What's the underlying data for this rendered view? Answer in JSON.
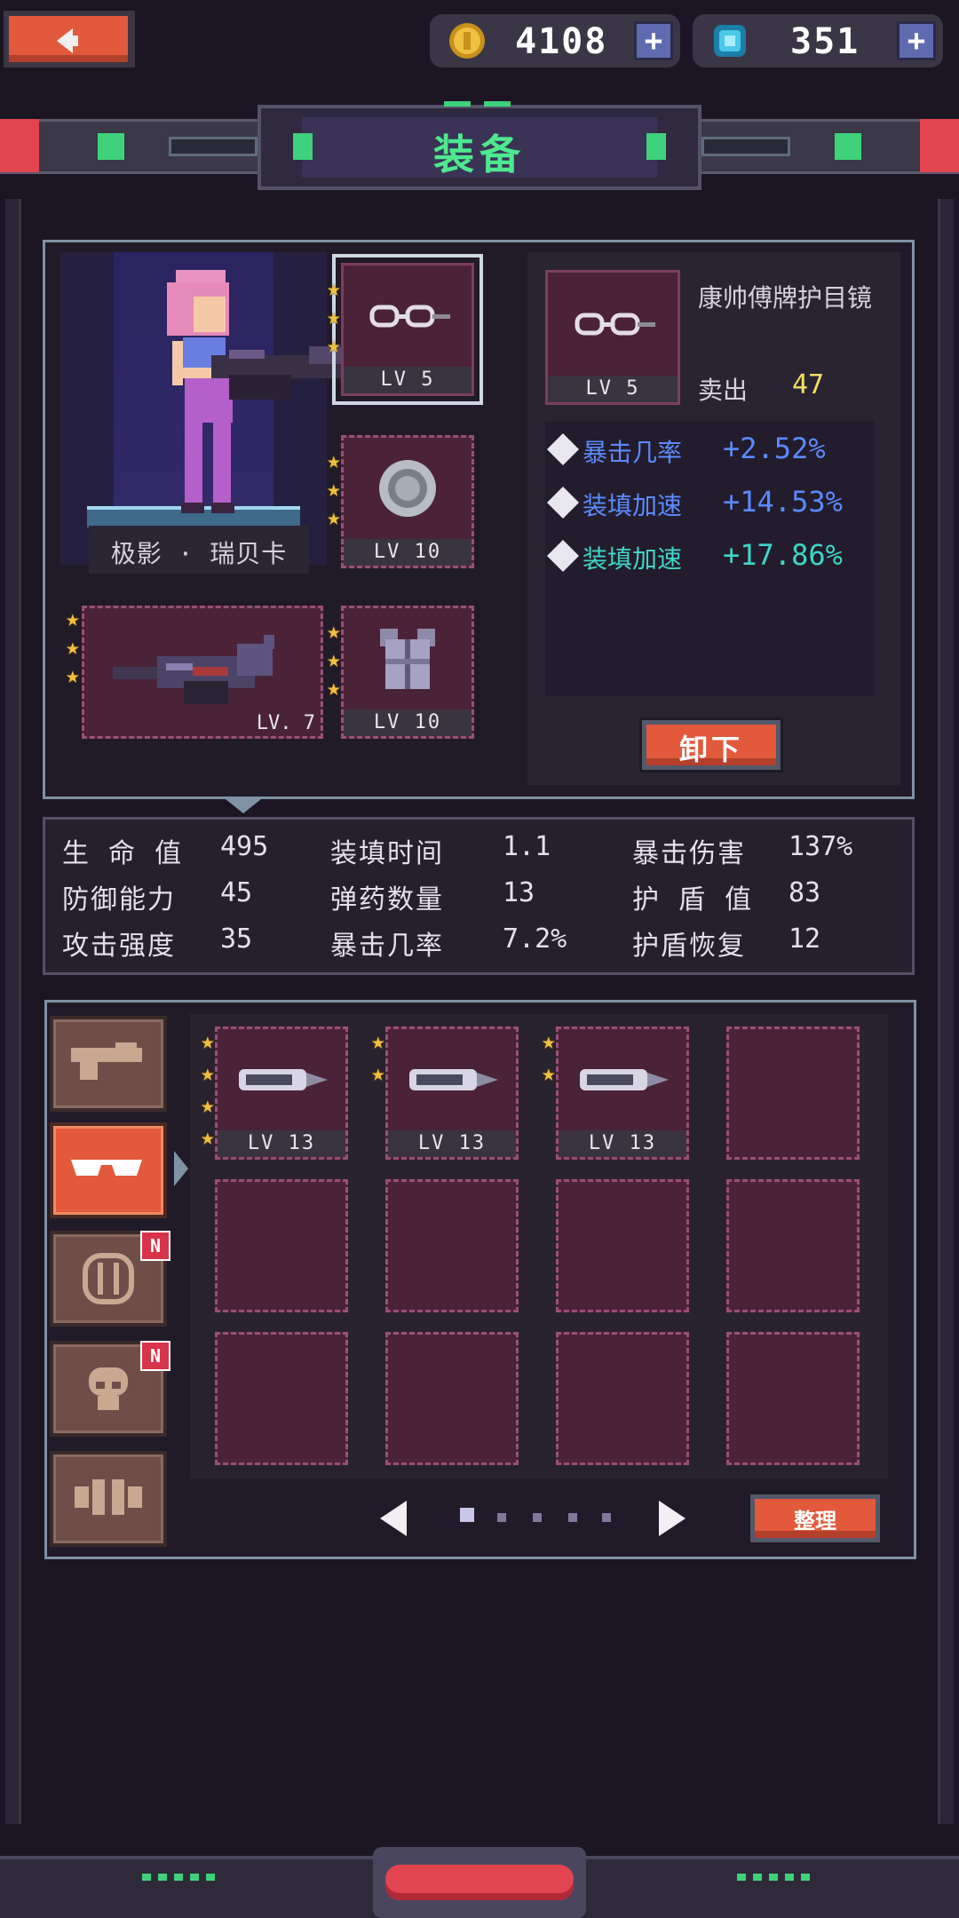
{
  "currency": {
    "gold": "4108",
    "gems": "351"
  },
  "header": {
    "title": "装备"
  },
  "character": {
    "name": "极影 · 瑞贝卡"
  },
  "equipped": {
    "accessory": {
      "lv": "LV 5",
      "stars": 3
    },
    "shield": {
      "lv": "LV 10",
      "stars": 3
    },
    "weapon": {
      "lv": "LV. 7",
      "stars": 3
    },
    "armor": {
      "lv": "LV 10",
      "stars": 3
    }
  },
  "detail": {
    "item_name": "康帅傅牌护目镜",
    "item_lv": "LV 5",
    "sell_label": "卖出",
    "sell_value": "47",
    "attributes": [
      {
        "name": "暴击几率",
        "value": "+2.52%",
        "color": "#5b8bff"
      },
      {
        "name": "装填加速",
        "value": "+14.53%",
        "color": "#5b8bff"
      },
      {
        "name": "装填加速",
        "value": "+17.86%",
        "color": "#3fd6c8"
      }
    ],
    "unequip_label": "卸下"
  },
  "stats": [
    {
      "label": "生 命 值",
      "value": "495"
    },
    {
      "label": "防御能力",
      "value": "45"
    },
    {
      "label": "攻击强度",
      "value": "35"
    },
    {
      "label": "装填时间",
      "value": "1.1"
    },
    {
      "label": "弹药数量",
      "value": "13"
    },
    {
      "label": "暴击几率",
      "value": "7.2%"
    },
    {
      "label": "暴击伤害",
      "value": "137%"
    },
    {
      "label": "护 盾 值",
      "value": "83"
    },
    {
      "label": "护盾恢复",
      "value": "12"
    }
  ],
  "inventory": {
    "tabs": [
      {
        "name": "weapon",
        "active": false,
        "new": false
      },
      {
        "name": "goggles",
        "active": true,
        "new": false
      },
      {
        "name": "shield",
        "active": false,
        "new": true,
        "badge": "N"
      },
      {
        "name": "helmet",
        "active": false,
        "new": true,
        "badge": "N"
      },
      {
        "name": "armor",
        "active": false,
        "new": false
      }
    ],
    "items": [
      {
        "lv": "LV 13",
        "stars": 4
      },
      {
        "lv": "LV 13",
        "stars": 2
      },
      {
        "lv": "LV 13",
        "stars": 2
      }
    ],
    "page_current": 1,
    "page_total": 5,
    "sort_label": "整理"
  },
  "colors": {
    "accent_orange": "#e2593b",
    "gold": "#f0c040",
    "slot_bg": "#4a2339"
  }
}
